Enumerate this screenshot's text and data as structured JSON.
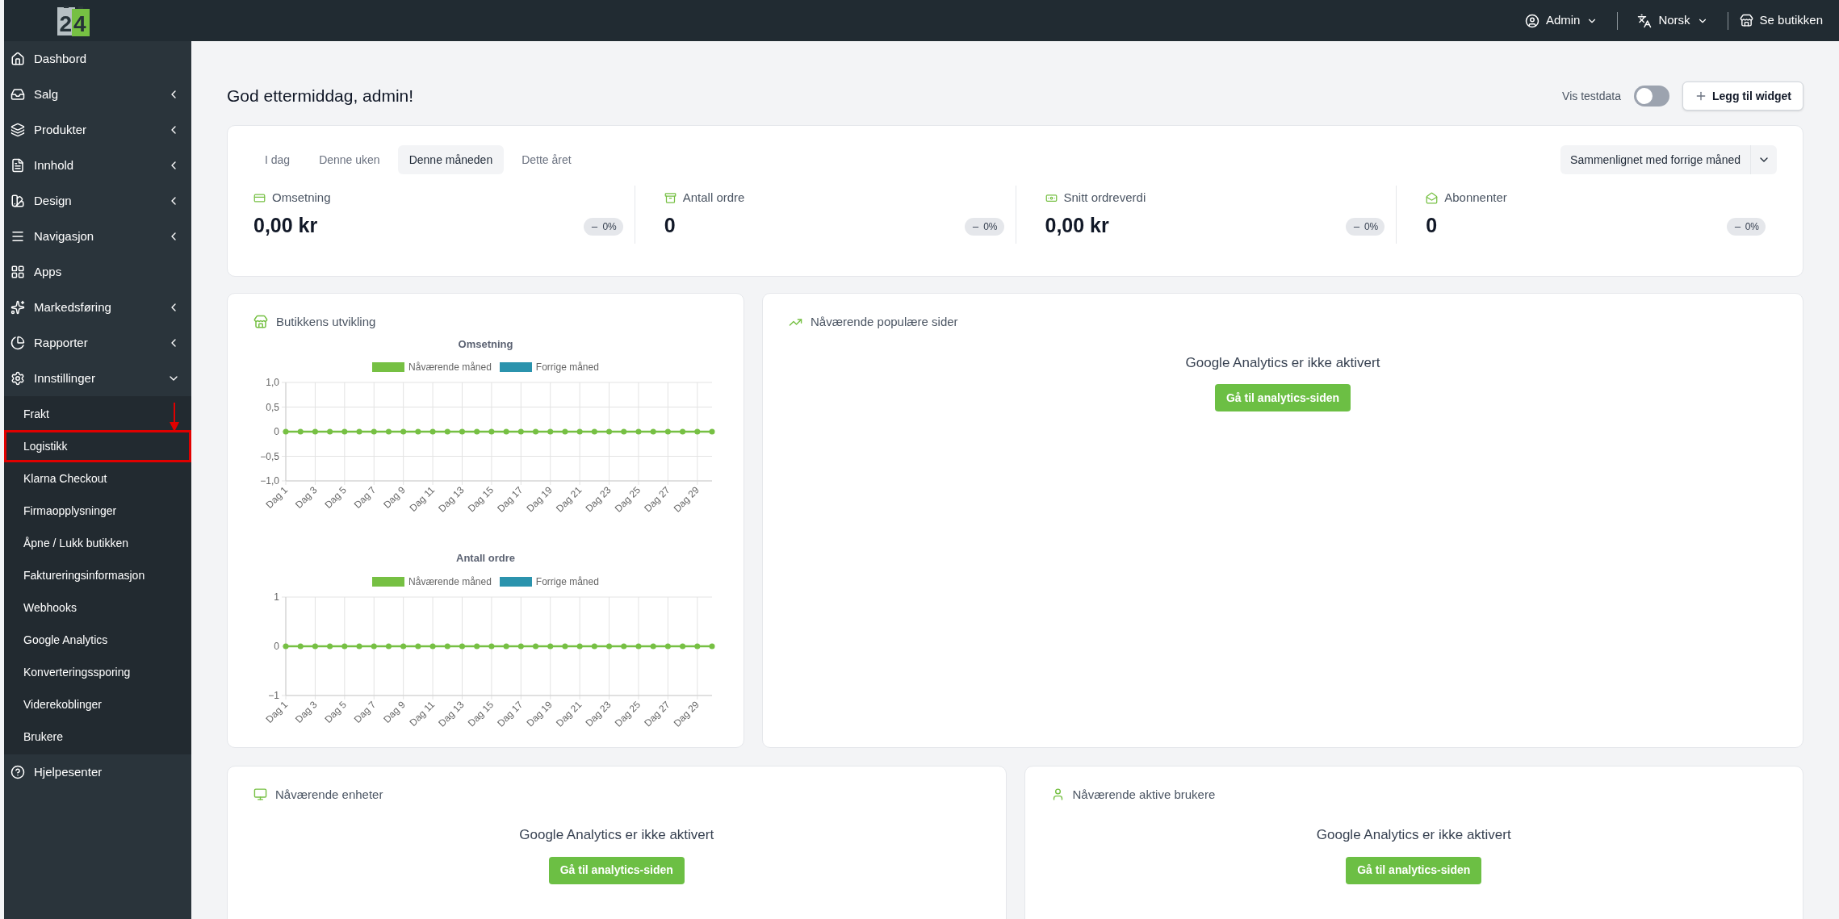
{
  "header": {
    "logo": "24",
    "user": "Admin",
    "language": "Norsk",
    "store_link": "Se butikken"
  },
  "sidebar": {
    "items": [
      {
        "label": "Dashbord"
      },
      {
        "label": "Salg",
        "expanded": false
      },
      {
        "label": "Produkter",
        "expanded": false
      },
      {
        "label": "Innhold",
        "expanded": false
      },
      {
        "label": "Design",
        "expanded": false
      },
      {
        "label": "Navigasjon",
        "expanded": false
      },
      {
        "label": "Apps"
      },
      {
        "label": "Markedsføring",
        "expanded": false
      },
      {
        "label": "Rapporter",
        "expanded": false
      },
      {
        "label": "Innstillinger",
        "expanded": true,
        "children": [
          {
            "label": "Frakt",
            "annotated": false
          },
          {
            "label": "Logistikk",
            "annotated": true
          },
          {
            "label": "Klarna Checkout",
            "annotated": false
          },
          {
            "label": "Firmaopplysninger",
            "annotated": false
          },
          {
            "label": "Åpne / Lukk butikken",
            "annotated": false
          },
          {
            "label": "Faktureringsinformasjon",
            "annotated": false
          },
          {
            "label": "Webhooks",
            "annotated": false
          },
          {
            "label": "Google Analytics",
            "annotated": false
          },
          {
            "label": "Konverteringssporing",
            "annotated": false
          },
          {
            "label": "Viderekoblinger",
            "annotated": false
          },
          {
            "label": "Brukere",
            "annotated": false
          }
        ]
      },
      {
        "label": "Hjelpesenter"
      }
    ]
  },
  "page": {
    "greeting": "God ettermiddag, admin!",
    "test_data_toggle": {
      "label": "Vis testdata",
      "on": false
    },
    "add_widget_button": "Legg til widget"
  },
  "summary": {
    "tabs": [
      {
        "label": "I dag",
        "selected": false
      },
      {
        "label": "Denne uken",
        "selected": false
      },
      {
        "label": "Denne måneden",
        "selected": true
      },
      {
        "label": "Dette året",
        "selected": false
      }
    ],
    "comparison": "Sammenlignet med forrige måned",
    "stats": [
      {
        "label": "Omsetning",
        "value": "0,00 kr",
        "change": "0%"
      },
      {
        "label": "Antall ordre",
        "value": "0",
        "change": "0%"
      },
      {
        "label": "Snitt ordreverdi",
        "value": "0,00 kr",
        "change": "0%"
      },
      {
        "label": "Abonnenter",
        "value": "0",
        "change": "0%"
      }
    ]
  },
  "development": {
    "title": "Butikkens utvikling",
    "charts": [
      {
        "chart_data": {
          "type": "line",
          "title": "Omsetning",
          "grid": true,
          "legend": "top",
          "categories": [
            "Dag 1",
            null,
            "Dag 3",
            null,
            "Dag 5",
            null,
            "Dag 7",
            null,
            "Dag 9",
            null,
            "Dag 11",
            null,
            "Dag 13",
            null,
            "Dag 15",
            null,
            "Dag 17",
            null,
            "Dag 19",
            null,
            "Dag 21",
            null,
            "Dag 23",
            null,
            "Dag 25",
            null,
            "Dag 27",
            null,
            "Dag 29",
            null
          ],
          "ylim": [
            -1,
            1
          ],
          "yticks": [
            {
              "value": 1,
              "label": "1,0"
            },
            {
              "value": 0.5,
              "label": "0,5"
            },
            {
              "value": 0,
              "label": "0"
            },
            {
              "value": -0.5,
              "label": "−0,5"
            },
            {
              "value": -1,
              "label": "−1,0"
            }
          ],
          "series": [
            {
              "name": "Nåværende måned",
              "color": "#76c043",
              "marker": true,
              "values": [
                0,
                0,
                0,
                0,
                0,
                0,
                0,
                0,
                0,
                0,
                0,
                0,
                0,
                0,
                0,
                0,
                0,
                0,
                0,
                0,
                0,
                0,
                0,
                0,
                0,
                0,
                0,
                0,
                0,
                0
              ]
            },
            {
              "name": "Forrige måned",
              "color": "#2b93ad",
              "values": [
                null,
                null,
                null,
                null,
                null,
                null,
                null,
                null,
                null,
                null,
                null,
                null,
                null,
                null,
                null,
                null,
                null,
                null,
                null,
                null,
                null,
                null,
                null,
                null,
                null,
                null,
                null,
                null,
                null,
                null
              ]
            }
          ]
        }
      },
      {
        "chart_data": {
          "type": "line",
          "title": "Antall ordre",
          "grid": true,
          "legend": "top",
          "categories": [
            "Dag 1",
            null,
            "Dag 3",
            null,
            "Dag 5",
            null,
            "Dag 7",
            null,
            "Dag 9",
            null,
            "Dag 11",
            null,
            "Dag 13",
            null,
            "Dag 15",
            null,
            "Dag 17",
            null,
            "Dag 19",
            null,
            "Dag 21",
            null,
            "Dag 23",
            null,
            "Dag 25",
            null,
            "Dag 27",
            null,
            "Dag 29",
            null
          ],
          "ylim": [
            -1,
            1
          ],
          "yticks": [
            {
              "value": 1,
              "label": "1"
            },
            {
              "value": 0,
              "label": "0"
            },
            {
              "value": -1,
              "label": "−1"
            }
          ],
          "series": [
            {
              "name": "Nåværende måned",
              "color": "#76c043",
              "marker": true,
              "values": [
                0,
                0,
                0,
                0,
                0,
                0,
                0,
                0,
                0,
                0,
                0,
                0,
                0,
                0,
                0,
                0,
                0,
                0,
                0,
                0,
                0,
                0,
                0,
                0,
                0,
                0,
                0,
                0,
                0,
                0
              ]
            },
            {
              "name": "Forrige måned",
              "color": "#2b93ad",
              "values": [
                null,
                null,
                null,
                null,
                null,
                null,
                null,
                null,
                null,
                null,
                null,
                null,
                null,
                null,
                null,
                null,
                null,
                null,
                null,
                null,
                null,
                null,
                null,
                null,
                null,
                null,
                null,
                null,
                null,
                null
              ]
            }
          ]
        }
      }
    ]
  },
  "popular_pages": {
    "title": "Nåværende populære sider",
    "message": "Google Analytics er ikke aktivert",
    "button": "Gå til analytics-siden"
  },
  "devices": {
    "title": "Nåværende enheter",
    "message": "Google Analytics er ikke aktivert",
    "button": "Gå til analytics-siden"
  },
  "active_users": {
    "title": "Nåværende aktive brukere",
    "message": "Google Analytics er ikke aktivert",
    "button": "Gå til analytics-siden"
  }
}
